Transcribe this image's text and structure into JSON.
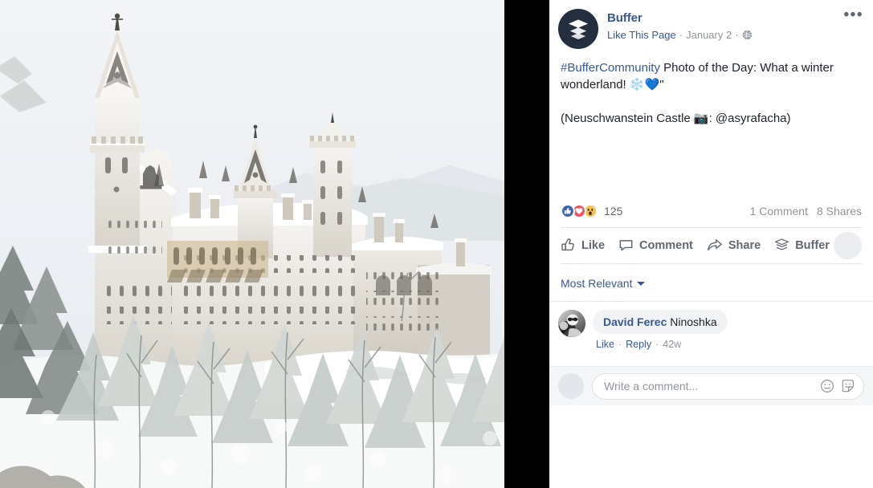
{
  "photo": {
    "alt_subject": "Neuschwanstein Castle in snow",
    "sky_color": "#eef1f5",
    "snow_color": "#ffffff",
    "stone_color": "#dcd9d2",
    "tree_color": "#6b6f6a"
  },
  "gutter": {
    "color": "#000000"
  },
  "post": {
    "page_name": "Buffer",
    "like_page_label": "Like This Page",
    "separator": "·",
    "date": "January 2",
    "privacy_icon": "globe-icon",
    "more_icon": "•••",
    "brand_avatar_icon": "buffer-stack-logo-icon",
    "message": {
      "hashtag": "#BufferCommunity",
      "line1_rest": " Photo of the Day: What a winter wonderland! ",
      "emoji1": "❄️",
      "emoji2": "💙",
      "trailing": "\"",
      "line2": "(Neuschwanstein Castle 📷: @asyrafacha)"
    }
  },
  "reactions": {
    "icons": [
      "like-reaction-icon",
      "love-reaction-icon",
      "wow-reaction-icon"
    ],
    "count": "125",
    "comments": "1 Comment",
    "shares": "8 Shares",
    "colors": {
      "like": "#4267B2",
      "love": "#ed5167",
      "wow": "#f7c14b"
    }
  },
  "actions": {
    "like": "Like",
    "comment": "Comment",
    "share": "Share",
    "buffer": "Buffer"
  },
  "sort": {
    "label": "Most Relevant"
  },
  "comment": {
    "author": "David Ferec",
    "text": "Ninoshka",
    "like": "Like",
    "reply": "Reply",
    "time": "42w",
    "sep": "·"
  },
  "composer": {
    "placeholder": "Write a comment...",
    "emoji_icon": "smiley-icon",
    "sticker_icon": "sticker-icon"
  }
}
